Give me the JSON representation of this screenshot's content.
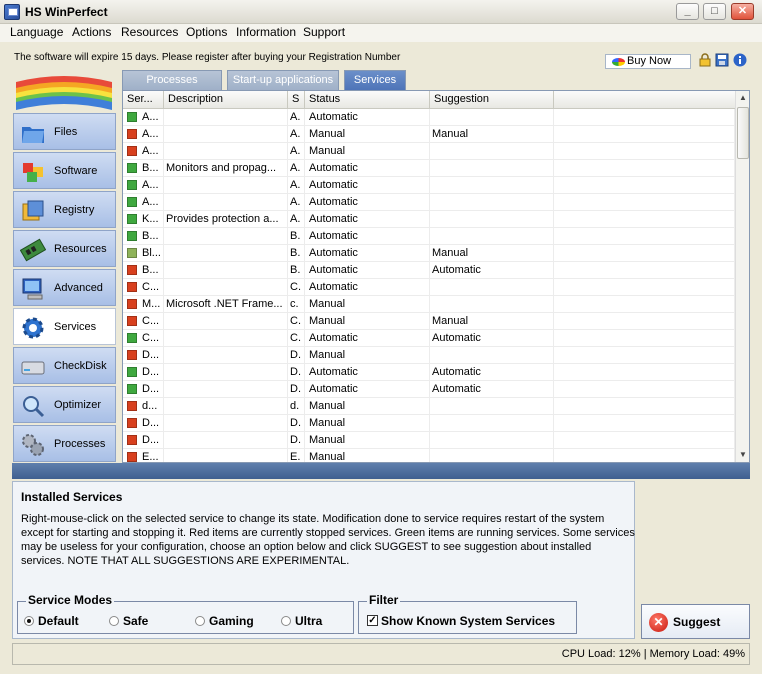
{
  "window": {
    "title": "HS WinPerfect"
  },
  "menu": [
    "Language",
    "Actions",
    "Resources",
    "Options",
    "Information",
    "Support"
  ],
  "notice": "The software will expire 15 days. Please register after buying your Registration Number",
  "buy_label": "Buy Now",
  "sidebar": [
    {
      "label": "Files",
      "icon": "folder-icon"
    },
    {
      "label": "Software",
      "icon": "software-icon"
    },
    {
      "label": "Registry",
      "icon": "registry-icon"
    },
    {
      "label": "Resources",
      "icon": "memory-icon"
    },
    {
      "label": "Advanced",
      "icon": "computer-icon"
    },
    {
      "label": "Services",
      "icon": "gear-icon"
    },
    {
      "label": "CheckDisk",
      "icon": "disk-icon"
    },
    {
      "label": "Optimizer",
      "icon": "magnifier-icon"
    },
    {
      "label": "Processes",
      "icon": "gears-icon"
    }
  ],
  "tabs": [
    "Processes",
    "Start-up applications",
    "Services"
  ],
  "table": {
    "headers": [
      "Ser...",
      "Description",
      "S",
      "Status",
      "Suggestion"
    ],
    "rows": [
      {
        "color": "green",
        "name": "A...",
        "desc": "",
        "s": "A.",
        "status": "Automatic",
        "sugg": ""
      },
      {
        "color": "red",
        "name": "A...",
        "desc": "",
        "s": "A.",
        "status": "Manual",
        "sugg": "Manual"
      },
      {
        "color": "red",
        "name": "A...",
        "desc": "",
        "s": "A.",
        "status": "Manual",
        "sugg": ""
      },
      {
        "color": "green",
        "name": "B...",
        "desc": "Monitors and propag...",
        "s": "A.",
        "status": "Automatic",
        "sugg": ""
      },
      {
        "color": "green",
        "name": "A...",
        "desc": "",
        "s": "A.",
        "status": "Automatic",
        "sugg": ""
      },
      {
        "color": "green",
        "name": "A...",
        "desc": "",
        "s": "A.",
        "status": "Automatic",
        "sugg": ""
      },
      {
        "color": "green",
        "name": "K...",
        "desc": "Provides protection a...",
        "s": "A.",
        "status": "Automatic",
        "sugg": ""
      },
      {
        "color": "green",
        "name": "B...",
        "desc": "",
        "s": "B.",
        "status": "Automatic",
        "sugg": ""
      },
      {
        "color": "key",
        "name": "Bl...",
        "desc": "",
        "s": "B.",
        "status": "Automatic",
        "sugg": "Manual"
      },
      {
        "color": "red",
        "name": "B...",
        "desc": "",
        "s": "B.",
        "status": "Automatic",
        "sugg": "Automatic"
      },
      {
        "color": "red",
        "name": "C...",
        "desc": "",
        "s": "C.",
        "status": "Automatic",
        "sugg": ""
      },
      {
        "color": "red",
        "name": "M...",
        "desc": "Microsoft .NET Frame...",
        "s": "c.",
        "status": "Manual",
        "sugg": ""
      },
      {
        "color": "red",
        "name": "C...",
        "desc": "",
        "s": "C.",
        "status": "Manual",
        "sugg": "Manual"
      },
      {
        "color": "green",
        "name": "C...",
        "desc": "",
        "s": "C.",
        "status": "Automatic",
        "sugg": "Automatic"
      },
      {
        "color": "red",
        "name": "D...",
        "desc": "",
        "s": "D.",
        "status": "Manual",
        "sugg": ""
      },
      {
        "color": "green",
        "name": "D...",
        "desc": "",
        "s": "D.",
        "status": "Automatic",
        "sugg": "Automatic"
      },
      {
        "color": "green",
        "name": "D...",
        "desc": "",
        "s": "D.",
        "status": "Automatic",
        "sugg": "Automatic"
      },
      {
        "color": "red",
        "name": "d...",
        "desc": "",
        "s": "d.",
        "status": "Manual",
        "sugg": ""
      },
      {
        "color": "red",
        "name": "D...",
        "desc": "",
        "s": "D.",
        "status": "Manual",
        "sugg": ""
      },
      {
        "color": "red",
        "name": "D...",
        "desc": "",
        "s": "D.",
        "status": "Manual",
        "sugg": ""
      },
      {
        "color": "red",
        "name": "E...",
        "desc": "",
        "s": "E.",
        "status": "Manual",
        "sugg": ""
      }
    ]
  },
  "info": {
    "title": "Installed Services",
    "text": "Right-mouse-click on the selected service to change its state. Modification done to service requires restart of the system except for starting and stopping it. Red items are currently stopped services. Green items are running services. Some services may be useless for your configuration, choose an option below and click SUGGEST to see suggestion about installed services. NOTE THAT ALL SUGGESTIONS ARE EXPERIMENTAL."
  },
  "modes": {
    "title": "Service Modes",
    "options": [
      "Default",
      "Safe",
      "Gaming",
      "Ultra"
    ],
    "selected": "Default"
  },
  "filter": {
    "title": "Filter",
    "label": "Show Known System Services",
    "checked": true
  },
  "suggest_label": "Suggest",
  "status": {
    "text": "CPU Load: 12%  |  Memory Load: 49%"
  },
  "colors": {
    "green": "#3fa83f",
    "red": "#d8401e",
    "accent": "#4e74b8"
  }
}
